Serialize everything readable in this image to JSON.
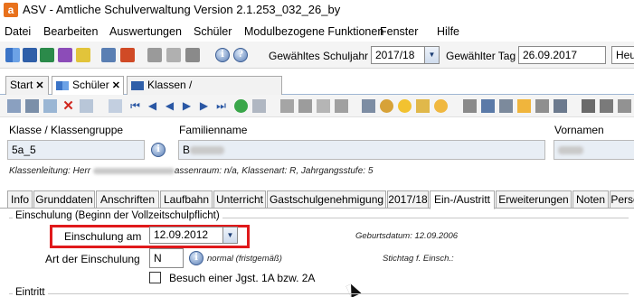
{
  "window": {
    "app_logo": "a",
    "title": "ASV - Amtliche Schulverwaltung Version 2.1.253_032_26_by"
  },
  "menu": [
    "Datei",
    "Bearbeiten",
    "Auswertungen",
    "Schüler",
    "Modulbezogene Funktionen",
    "Fenster",
    "Hilfe"
  ],
  "toolbar": {
    "schuljahr_label": "Gewähltes Schuljahr",
    "schuljahr_value": "2017/18",
    "tag_label": "Gewählter Tag",
    "tag_value": "26.09.2017",
    "heute_label": "Heu"
  },
  "open_tabs": [
    {
      "label": "Start",
      "close": "✕"
    },
    {
      "label": "Schüler",
      "close": "✕"
    },
    {
      "label": "Klassen / Klassengruppen",
      "close": "✕"
    }
  ],
  "header": {
    "klasse_label": "Klasse / Klassengruppe",
    "klasse_value": "5a_5",
    "familienname_label": "Familienname",
    "familienname_initial": "B",
    "vornamen_label": "Vornamen",
    "klassenleitung_prefix": "Klassenleitung: Herr",
    "klassenleitung_suffix": "assenraum: n/a, Klassenart: R, Jahrgangsstufe: 5"
  },
  "detail_tabs": [
    "Info",
    "Grunddaten",
    "Anschriften",
    "Laufbahn",
    "Unterricht",
    "Gastschulgenehmigung",
    "2017/18",
    "Ein-/Austritt",
    "Erweiterungen",
    "Noten",
    "Perso"
  ],
  "active_detail_tab": "Ein-/Austritt",
  "einschulung": {
    "section_title": "Einschulung (Beginn der Vollzeitschulpflicht)",
    "einschulung_label": "Einschulung am",
    "einschulung_value": "12.09.2012",
    "geburtsdatum": "Geburtsdatum: 12.09.2006",
    "art_label": "Art der Einschulung",
    "art_value": "N",
    "art_hint": "normal (fristgemäß)",
    "stichtag": "Stichtag f. Einsch.:",
    "besuch_label": "Besuch einer Jgst. 1A bzw. 2A"
  },
  "eintritt": {
    "section_title": "Eintritt"
  },
  "colors": {
    "highlight_box": "#e0191b",
    "tab_border": "#9fb6d3",
    "field_bg": "#e8eef5"
  }
}
